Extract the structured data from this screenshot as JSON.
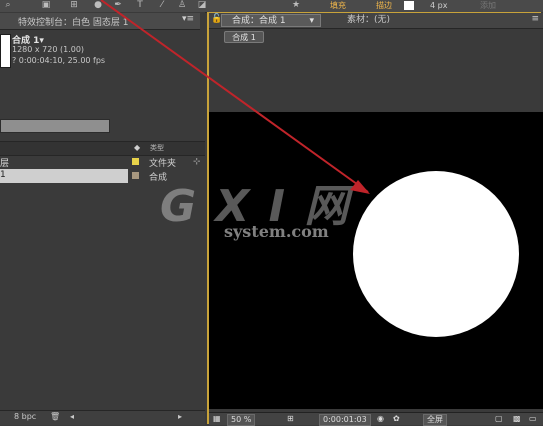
{
  "toolbar": {
    "fill_label": "填充",
    "stroke_label": "描边",
    "stroke_width": "4 px",
    "extra_label": "添加"
  },
  "effects_panel": {
    "tab_label": "特效控制台：白色 固态层 1",
    "comp_name": "合成 1▾",
    "comp_size": "1280 x 720 (1.00)",
    "comp_duration": "? 0:00:04:10, 25.00 fps"
  },
  "project": {
    "type_header": "类型",
    "name_header": "层",
    "rows": [
      {
        "name": "",
        "type": "文件夹",
        "swatch": "#e8d34a"
      },
      {
        "name": "1",
        "type": "合成",
        "swatch": "#a89880"
      }
    ],
    "bottom_text": "8 bpc"
  },
  "viewer": {
    "tab_active": "合成：合成 1",
    "tab_inactive": "素材：(无)",
    "breadcrumb": "合成 1",
    "zoom": "50 %",
    "timecode": "0:00:01:03",
    "resolution": "全屏"
  },
  "watermark": {
    "main": "G X I 网",
    "sub": "system.com"
  },
  "colors": {
    "accent_frame": "#c8a33a",
    "arrow": "#c0242a",
    "shape": "#ffffff"
  }
}
